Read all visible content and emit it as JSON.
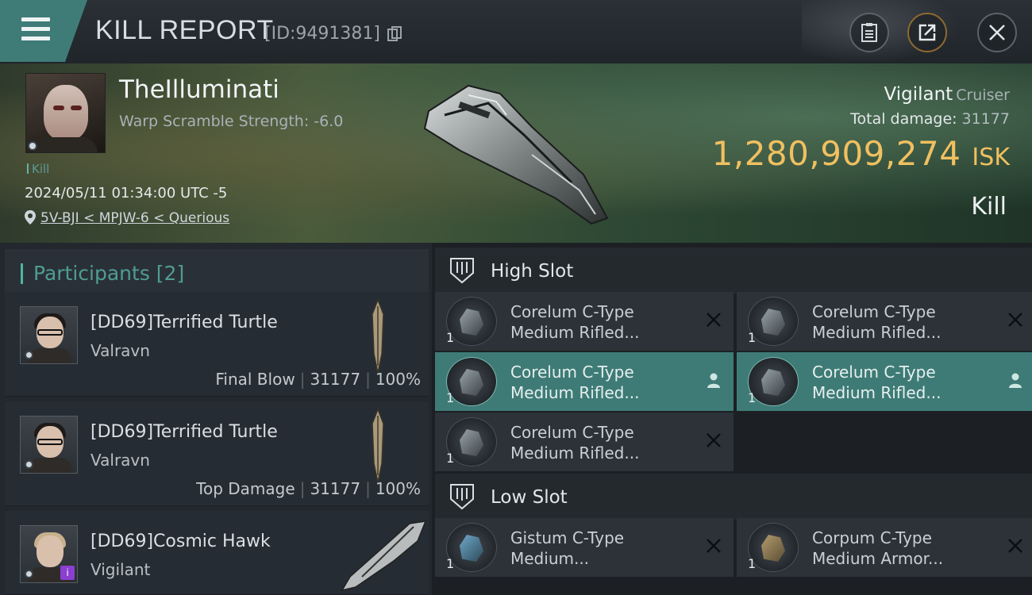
{
  "header": {
    "title": "KILL REPORT",
    "id_text": "[ID:9491381]",
    "menu_icon": "hamburger-icon",
    "buttons": [
      "clipboard-icon",
      "share-icon",
      "close-icon"
    ]
  },
  "victim": {
    "name": "TheIlluminati",
    "warp_scramble": "Warp Scramble Strength: -6.0",
    "kill_tag": "Kill",
    "time": "2024/05/11 01:34:00 UTC -5",
    "location": "5V-BJI < MPJW-6 < Querious",
    "ship_name": "Vigilant",
    "ship_class": "Cruiser",
    "total_damage_label": "Total damage:",
    "total_damage": "31177",
    "isk_value": "1,280,909,274",
    "isk_unit": "ISK",
    "result": "Kill"
  },
  "participants": {
    "title": "Participants [2]",
    "rows": [
      {
        "name": "[DD69]Terrified Turtle",
        "ship": "Valravn",
        "role": "Final Blow",
        "damage": "31177",
        "percent": "100%"
      },
      {
        "name": "[DD69]Terrified Turtle",
        "ship": "Valravn",
        "role": "Top Damage",
        "damage": "31177",
        "percent": "100%"
      },
      {
        "name": "[DD69]Cosmic Hawk",
        "ship": "Vigilant"
      }
    ]
  },
  "slots": {
    "high": {
      "title": "High Slot",
      "modules": [
        {
          "line1": "Corelum C-Type",
          "line2": "Medium Rifled...",
          "qty": "1",
          "state": "destroyed"
        },
        {
          "line1": "Corelum C-Type",
          "line2": "Medium Rifled...",
          "qty": "1",
          "state": "destroyed"
        },
        {
          "line1": "Corelum C-Type",
          "line2": "Medium Rifled...",
          "qty": "1",
          "state": "dropped"
        },
        {
          "line1": "Corelum C-Type",
          "line2": "Medium Rifled...",
          "qty": "1",
          "state": "dropped"
        },
        {
          "line1": "Corelum C-Type",
          "line2": "Medium Rifled...",
          "qty": "1",
          "state": "destroyed"
        }
      ]
    },
    "low": {
      "title": "Low Slot",
      "modules": [
        {
          "line1": "Gistum C-Type",
          "line2": "Medium...",
          "qty": "1",
          "state": "destroyed"
        },
        {
          "line1": "Corpum C-Type",
          "line2": "Medium Armor...",
          "qty": "1",
          "state": "destroyed"
        }
      ]
    }
  },
  "colors": {
    "accent": "#3e7b76",
    "isk": "#f0c060",
    "teal_text": "#4f9c93"
  }
}
